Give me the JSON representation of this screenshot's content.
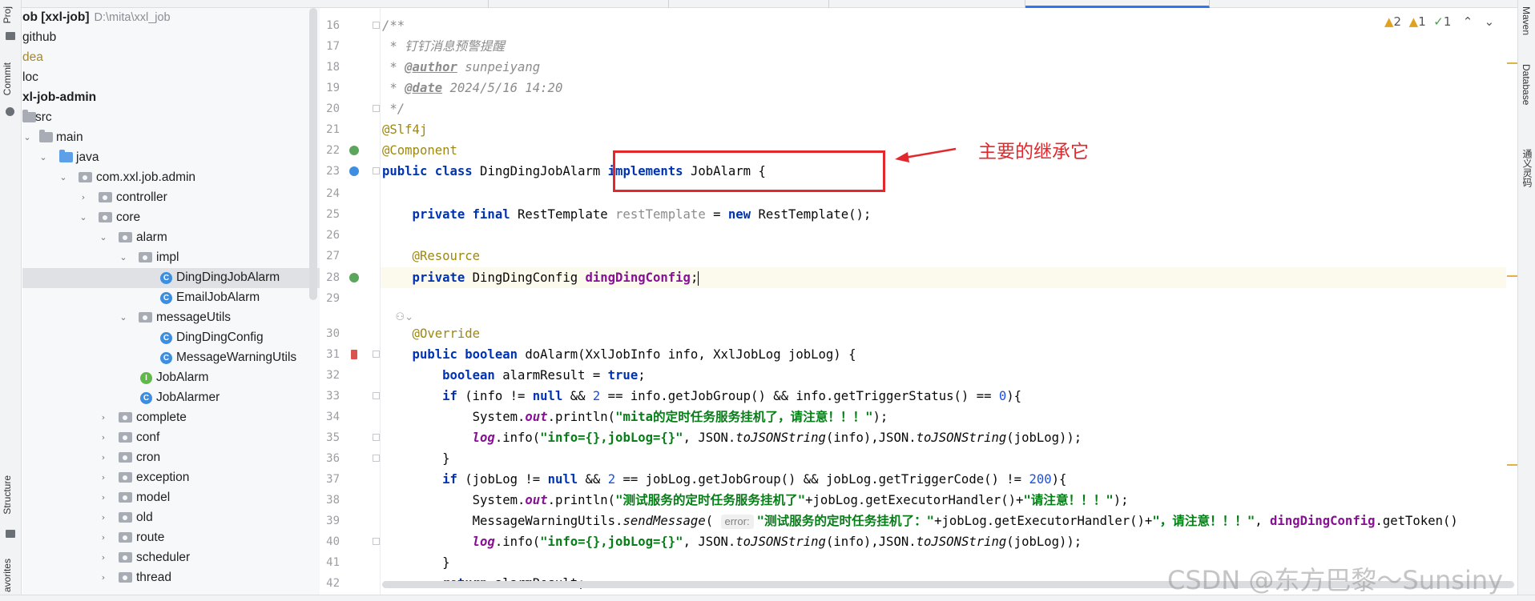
{
  "project_tree": {
    "rows": [
      {
        "label": "ob [xxl-job]",
        "path": "D:\\mita\\xxl_job"
      },
      {
        "label": "github"
      },
      {
        "label": "dea"
      },
      {
        "label": "loc"
      },
      {
        "label": "xl-job-admin"
      },
      {
        "label": "src"
      },
      {
        "label": "main"
      },
      {
        "label": "java"
      },
      {
        "label": "com.xxl.job.admin"
      },
      {
        "label": "controller"
      },
      {
        "label": "core"
      },
      {
        "label": "alarm"
      },
      {
        "label": "impl"
      },
      {
        "label": "DingDingJobAlarm"
      },
      {
        "label": "EmailJobAlarm"
      },
      {
        "label": "messageUtils"
      },
      {
        "label": "DingDingConfig"
      },
      {
        "label": "MessageWarningUtils"
      },
      {
        "label": "JobAlarm"
      },
      {
        "label": "JobAlarmer"
      },
      {
        "label": "complete"
      },
      {
        "label": "conf"
      },
      {
        "label": "cron"
      },
      {
        "label": "exception"
      },
      {
        "label": "model"
      },
      {
        "label": "old"
      },
      {
        "label": "route"
      },
      {
        "label": "scheduler"
      },
      {
        "label": "thread"
      }
    ]
  },
  "left_strip": {
    "project": "Proj",
    "commit": "Commit",
    "structure": "Structure",
    "favorites": "avorites"
  },
  "right_strip": {
    "maven": "Maven",
    "database": "Database",
    "plugin": "通义灵码"
  },
  "inspections": {
    "warnings": "2",
    "weak_warnings": "1",
    "typos": "1"
  },
  "editor": {
    "line_numbers": [
      "16",
      "17",
      "18",
      "19",
      "20",
      "21",
      "22",
      "23",
      "24",
      "25",
      "26",
      "27",
      "28",
      "29",
      "30",
      "31",
      "32",
      "33",
      "34",
      "35",
      "36",
      "37",
      "38",
      "39",
      "40",
      "41",
      "42"
    ],
    "lines": {
      "l16": "/**",
      "l17": " * 钉钉消息预警提醒",
      "l18_a": " * ",
      "l18_tag": "@author",
      "l18_b": " sunpeiyang",
      "l19_a": " * ",
      "l19_tag": "@date",
      "l19_b": " 2024/5/16 14:20",
      "l20": " */",
      "l21": "@Slf4j",
      "l22": "@Component",
      "l23_kw": "public class",
      "l23_a": " DingDingJobAlarm ",
      "l23_kw2": "implements",
      "l23_b": " JobAlarm {",
      "l25_kw": "    private final",
      "l25_a": " RestTemplate ",
      "l25_f": "restTemplate",
      "l25_b": " = ",
      "l25_kw2": "new",
      "l25_c": " RestTemplate();",
      "l27": "    @Resource",
      "l28_kw": "    private",
      "l28_a": " DingDingConfig ",
      "l28_f": "dingDingConfig",
      "l28_b": ";",
      "l29_bulb": "    ⚇⌄",
      "l30": "    @Override",
      "l31_kw": "    public boolean",
      "l31_a": " doAlarm(XxlJobInfo info, XxlJobLog jobLog) {",
      "l32_kw": "        boolean",
      "l32_a": " alarmResult = ",
      "l32_kw2": "true",
      "l32_b": ";",
      "l33_kw": "        if",
      "l33_a": " (info != ",
      "l33_kw2": "null",
      "l33_b": " && ",
      "l33_n": "2",
      "l33_c": " == info.getJobGroup() && info.getTriggerStatus() == ",
      "l33_n2": "0",
      "l33_d": "){",
      "l34_a": "            System.",
      "l34_f": "out",
      "l34_b": ".println(",
      "l34_s": "\"mita的定时任务服务挂机了，请注意！！！\"",
      "l34_c": ");",
      "l35_f": "            log",
      "l35_a": ".info(",
      "l35_s": "\"info={},jobLog={}\"",
      "l35_b": ", JSON.",
      "l35_m": "toJSONString",
      "l35_c": "(info),JSON.",
      "l35_m2": "toJSONString",
      "l35_d": "(jobLog));",
      "l36": "        }",
      "l37_kw": "        if",
      "l37_a": " (jobLog != ",
      "l37_kw2": "null",
      "l37_b": " && ",
      "l37_n": "2",
      "l37_c": " == jobLog.getJobGroup() && jobLog.getTriggerCode() != ",
      "l37_n2": "200",
      "l37_d": "){",
      "l38_a": "            System.",
      "l38_f": "out",
      "l38_b": ".println(",
      "l38_s": "\"测试服务的定时任务服务挂机了\"",
      "l38_c": "+jobLog.getExecutorHandler()+",
      "l38_s2": "\"请注意！！！\"",
      "l38_d": ");",
      "l39_a": "            MessageWarningUtils.",
      "l39_m": "sendMessage",
      "l39_b": "( ",
      "l39_hint": "error:",
      "l39_s": "\"测试服务的定时任务挂机了：\"",
      "l39_c": "+jobLog.getExecutorHandler()+",
      "l39_s2": "\"，请注意！！！\"",
      "l39_d": ", ",
      "l39_f": "dingDingConfig",
      "l39_e": ".getToken()",
      "l40_f": "            log",
      "l40_a": ".info(",
      "l40_s": "\"info={},jobLog={}\"",
      "l40_b": ", JSON.",
      "l40_m": "toJSONString",
      "l40_c": "(info),JSON.",
      "l40_m2": "toJSONString",
      "l40_d": "(jobLog));",
      "l41": "        }",
      "l42_kw": "        return",
      "l42_a": " alarmResult;"
    }
  },
  "annotation": {
    "note": "主要的继承它"
  },
  "watermark": "CSDN @东方巴黎～Sunsiny"
}
